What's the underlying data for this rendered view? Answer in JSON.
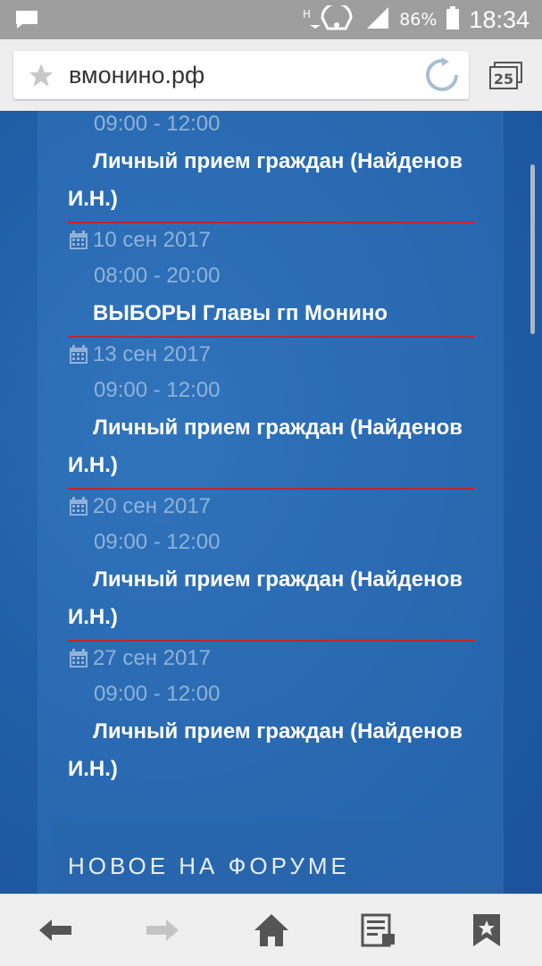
{
  "status": {
    "battery": "86%",
    "time": "18:34"
  },
  "browser": {
    "url": "вмонино.рф",
    "tabs_count": "25"
  },
  "events": [
    {
      "date": "",
      "time": "09:00 - 12:00",
      "title": "Личный прием граждан (Найденов И.Н.)"
    },
    {
      "date": "10 сен 2017",
      "time": "08:00 - 20:00",
      "title": "ВЫБОРЫ Главы гп Монино"
    },
    {
      "date": "13 сен 2017",
      "time": "09:00 - 12:00",
      "title": "Личный прием граждан (Найденов И.Н.)"
    },
    {
      "date": "20 сен 2017",
      "time": "09:00 - 12:00",
      "title": "Личный прием граждан (Найденов И.Н.)"
    },
    {
      "date": "27 сен 2017",
      "time": "09:00 - 12:00",
      "title": "Личный прием граждан (Найденов И.Н.)"
    }
  ],
  "forum": {
    "title": "НОВОЕ НА ФОРУМЕ"
  },
  "colors": {
    "accent_line": "#c0262d",
    "page_bg": "#1e5da3",
    "muted_text": "#8fb3d8"
  }
}
